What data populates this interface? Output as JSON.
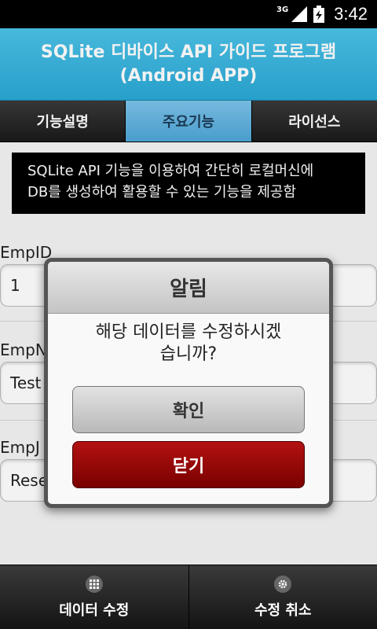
{
  "status_bar": {
    "network": "3G",
    "time": "3:42"
  },
  "header": {
    "title_line1": "SQLite 디바이스 API 가이드 프로그램",
    "title_line2": "(Android APP)"
  },
  "tabs": [
    {
      "label": "기능설명",
      "active": false
    },
    {
      "label": "주요기능",
      "active": true
    },
    {
      "label": "라이선스",
      "active": false
    }
  ],
  "info": {
    "line1": "SQLite API 기능을 이용하여 간단히 로컬머신에",
    "line2": "DB를 생성하여 활용할 수 있는 기능을 제공함"
  },
  "form": {
    "emp_id_label": "EmpID",
    "emp_id_value": "1",
    "emp_name_label": "EmpN",
    "emp_name_value": "Test",
    "emp_job_label": "EmpJ",
    "emp_job_value": "Rese"
  },
  "dialog": {
    "title": "알림",
    "message_line1": "해당 데이터를 수정하시겠",
    "message_line2": "습니까?",
    "confirm_label": "확인",
    "close_label": "닫기"
  },
  "bottom_bar": {
    "edit_label": "데이터 수정",
    "cancel_label": "수정 취소",
    "edit_icon": "grid-icon",
    "cancel_icon": "gear-icon"
  },
  "colors": {
    "header": "#2aa8d6",
    "active_tab": "#7cc4ea",
    "close_button": "#8b0000"
  }
}
